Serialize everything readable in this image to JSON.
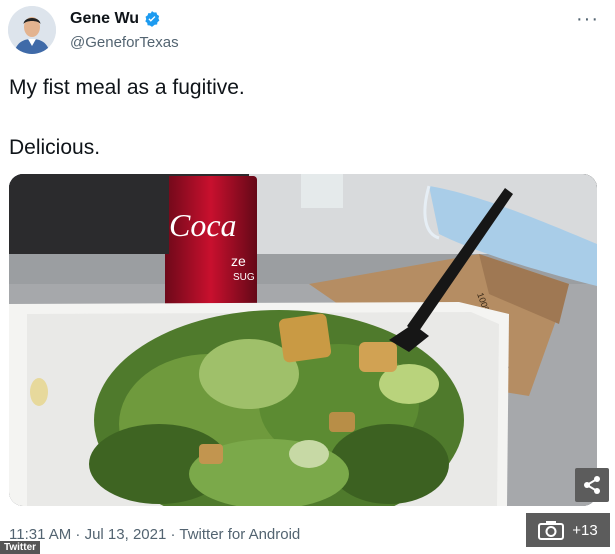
{
  "tweet": {
    "display_name": "Gene Wu",
    "handle": "@GeneforTexas",
    "lines": [
      "My fist meal as a fugitive.",
      "Delicious."
    ],
    "timestamp": "11:31 AM · Jul 13, 2021 · Twitter for Android"
  },
  "media": {
    "can_text": "Coca",
    "can_subtext": "ze",
    "can_subtext2": "SUG",
    "bag_text": "100% recycled mate"
  },
  "overlay": {
    "share_icon": "share-icon",
    "gallery_icon": "camera-icon",
    "gallery_count": "+13",
    "credit": "Twitter"
  },
  "colors": {
    "verified": "#1d9bf0",
    "coke_red": "#c8102e"
  }
}
